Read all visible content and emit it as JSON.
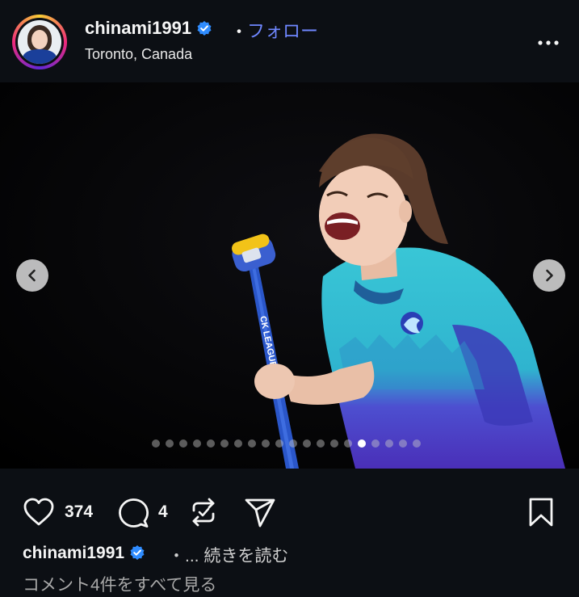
{
  "header": {
    "username": "chinami1991",
    "separator": "・",
    "follow_label": "フォロー",
    "location": "Toronto, Canada"
  },
  "media": {
    "slide_count": 20,
    "active_slide_index": 15,
    "stick_text": "CK LEAGUE"
  },
  "actions": {
    "likes": "374",
    "comments": "4"
  },
  "caption": {
    "username": "chinami1991",
    "separator": "・",
    "ellipsis": "...",
    "more_label": "続きを読む"
  },
  "comments_link": "コメント4件をすべて見る",
  "colors": {
    "background": "#0c0f14",
    "follow_blue": "#6f87ff",
    "verified_blue": "#2f8cff"
  }
}
